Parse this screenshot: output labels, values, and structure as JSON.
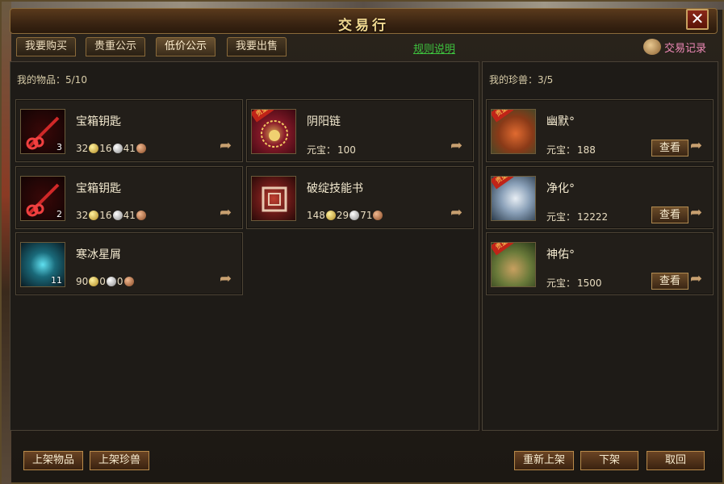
{
  "window": {
    "title": "交易行"
  },
  "tabs": [
    {
      "label": "我要购买"
    },
    {
      "label": "贵重公示"
    },
    {
      "label": "低价公示"
    },
    {
      "label": "我要出售"
    }
  ],
  "rules_link": "规则说明",
  "records_label": "交易记录",
  "items_panel": {
    "header": "我的物品：5/10"
  },
  "pets_panel": {
    "header": "我的珍兽：3/5"
  },
  "items": [
    {
      "name": "宝箱钥匙",
      "qty": "3",
      "gold": "32",
      "silver": "16",
      "copper": "41",
      "ribbon": "",
      "icon": "key-icon",
      "color": "#c02020"
    },
    {
      "name": "阴阳链",
      "qty": "",
      "price_label": "元宝：",
      "price": "100",
      "ribbon": "贵重",
      "icon": "necklace-icon",
      "color": "#8a1a2a"
    },
    {
      "name": "宝箱钥匙",
      "qty": "2",
      "gold": "32",
      "silver": "16",
      "copper": "41",
      "ribbon": "",
      "icon": "key-icon",
      "color": "#c02020"
    },
    {
      "name": "破绽技能书",
      "qty": "",
      "gold": "148",
      "silver": "29",
      "copper": "71",
      "ribbon": "",
      "icon": "skill-book-icon",
      "color": "#7a2a28"
    },
    {
      "name": "寒冰星屑",
      "qty": "11",
      "gold": "90",
      "silver": "0",
      "copper": "0",
      "ribbon": "",
      "icon": "ice-shard-icon",
      "color": "#1a6a7a"
    }
  ],
  "pets": [
    {
      "name": "幽默°",
      "price_label": "元宝：",
      "price": "188",
      "view": "查看",
      "ribbon": "贵重",
      "icon": "fish-pet-icon"
    },
    {
      "name": "净化°",
      "price_label": "元宝：",
      "price": "12222",
      "view": "查看",
      "ribbon": "贵重",
      "icon": "wolf-pet-icon"
    },
    {
      "name": "神佑°",
      "price_label": "元宝：",
      "price": "1500",
      "view": "查看",
      "ribbon": "贵重",
      "icon": "tortoise-pet-icon"
    }
  ],
  "buttons": {
    "list_item": "上架物品",
    "list_pet": "上架珍兽",
    "relist": "重新上架",
    "delist": "下架",
    "cancel": "取回"
  },
  "colors": {
    "accent_gold": "#f0d890",
    "link_green": "#3ec23e",
    "records_pink": "#f08ab8"
  }
}
